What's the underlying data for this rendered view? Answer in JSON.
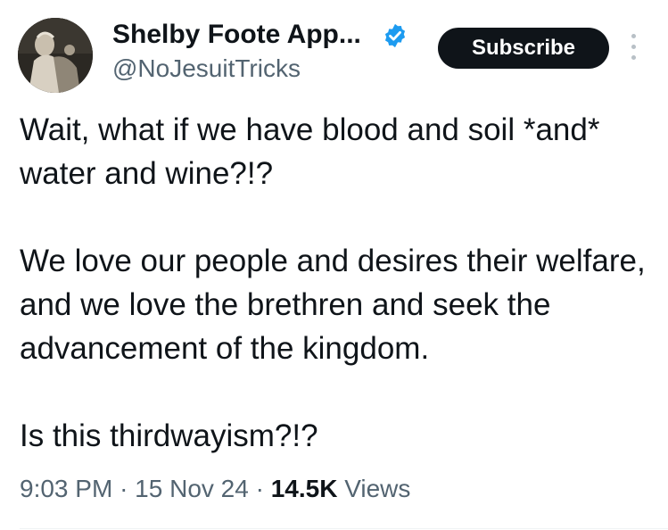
{
  "author": {
    "display_name": "Shelby Foote App...",
    "handle": "@NoJesuitTricks",
    "verified": true,
    "avatar": "portrait-avatar"
  },
  "actions": {
    "subscribe_label": "Subscribe",
    "more_icon": "more-vertical-icon"
  },
  "tweet": {
    "paragraphs": [
      "Wait, what if we have blood and soil *and* water and wine?!?",
      "We love our people and desires their welfare, and we love the brethren and seek the advancement of the kingdom.",
      "Is this thirdwayism?!?"
    ]
  },
  "meta": {
    "time": "9:03 PM",
    "separator": "·",
    "date": "15 Nov 24",
    "views_count": "14.5K",
    "views_label": "Views"
  },
  "colors": {
    "text": "#0f1419",
    "secondary": "#536471",
    "verified": "#1d9bf0",
    "button_bg": "#0f1419"
  }
}
